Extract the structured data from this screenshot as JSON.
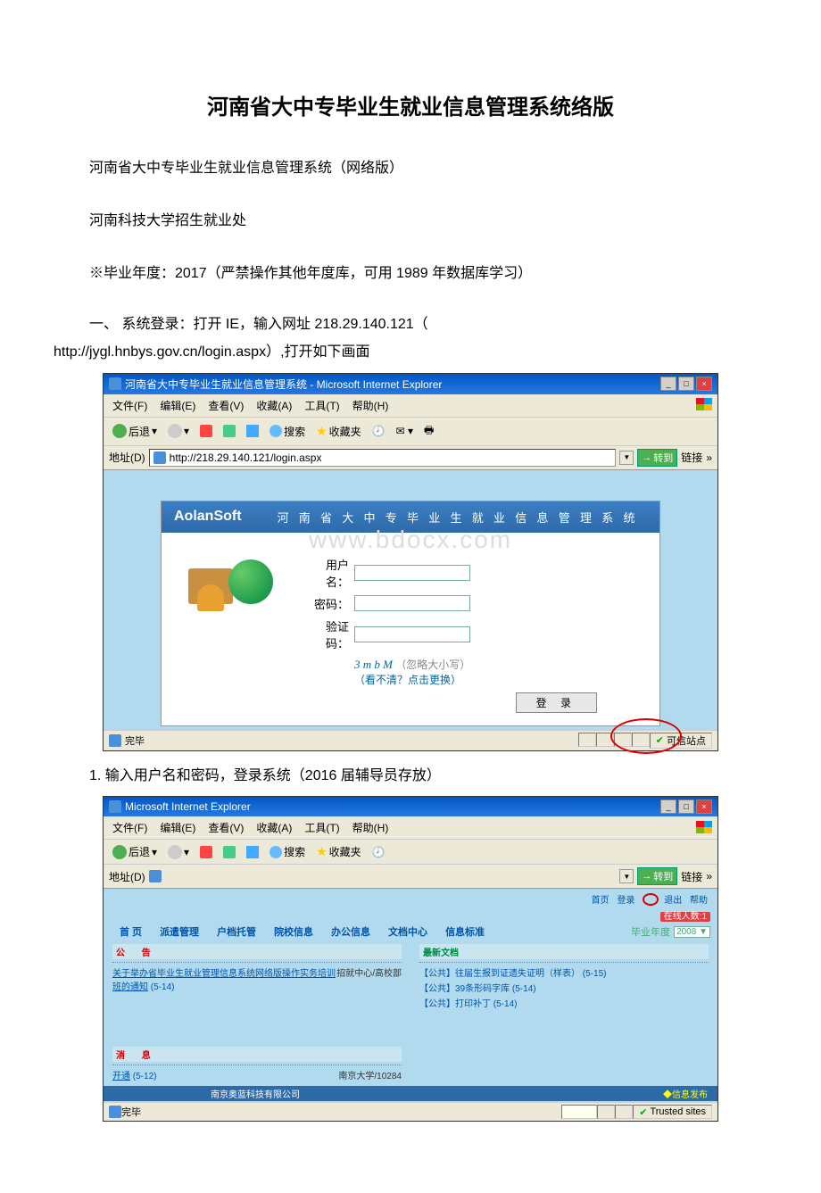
{
  "doc": {
    "title": "河南省大中专毕业生就业信息管理系统络版",
    "p1": "河南省大中专毕业生就业信息管理系统（网络版）",
    "p2": "河南科技大学招生就业处",
    "p3": "※毕业年度：2017（严禁操作其他年度库，可用 1989 年数据库学习）",
    "p4": "一、 系统登录：打开 IE，输入网址 218.29.140.121（",
    "p4url": "http://jygl.hnbys.gov.cn/login.aspx）,打开如下画面",
    "p5": "1. 输入用户名和密码，登录系统（2016 届辅导员存放）"
  },
  "ie1": {
    "title": "河南省大中专毕业生就业信息管理系统 - Microsoft Internet Explorer",
    "menu": {
      "file": "文件(F)",
      "edit": "编辑(E)",
      "view": "查看(V)",
      "fav": "收藏(A)",
      "tools": "工具(T)",
      "help": "帮助(H)"
    },
    "toolbar": {
      "back": "后退",
      "search": "搜索",
      "favorites": "收藏夹"
    },
    "address": {
      "label": "地址(D)",
      "url": "http://218.29.140.121/login.aspx",
      "go": "转到",
      "links": "链接"
    },
    "login": {
      "logo": "AolanSoft",
      "system_title": "河 南 省 大 中 专 毕 业 生 就 业 信 息 管 理 系 统",
      "watermark": "www.bdocx.com",
      "username_label": "用户名：",
      "password_label": "密码：",
      "captcha_label": "验证码：",
      "captcha_value": "3 m b M",
      "captcha_hint": "（忽略大小写）",
      "captcha_link": "（看不清？点击更换）",
      "login_btn": "登 录"
    },
    "status": {
      "done": "完毕",
      "trusted": "可信站点"
    }
  },
  "ie2": {
    "title": "Microsoft Internet Explorer",
    "menu": {
      "file": "文件(F)",
      "edit": "编辑(E)",
      "view": "查看(V)",
      "fav": "收藏(A)",
      "tools": "工具(T)",
      "help": "帮助(H)"
    },
    "toolbar": {
      "back": "后退",
      "search": "搜索",
      "favorites": "收藏夹"
    },
    "address": {
      "label": "地址(D)",
      "go": "转到",
      "links": "链接"
    },
    "toplinks": {
      "home": "首页",
      "login": "登录",
      "logout": "退出",
      "help": "帮助"
    },
    "online": {
      "label": "在线人数:",
      "count": "1"
    },
    "navtabs": {
      "t1": "首 页",
      "t2": "派遣管理",
      "t3": "户档托管",
      "t4": "院校信息",
      "t5": "办公信息",
      "t6": "文档中心",
      "t7": "信息标准",
      "year_label": "毕业年度",
      "year_value": "2008"
    },
    "left": {
      "notice_hdr": "公  告",
      "notice_item": "关于举办省毕业生就业管理信息系统网络版操作实务培训班的通知",
      "notice_date": "(5-14)",
      "notice_src": "招就中心/高校部",
      "msg_hdr": "消  息",
      "msg_item": "开通",
      "msg_date": "(5-12)",
      "msg_src": "南京大学/10284"
    },
    "right": {
      "docs_hdr": "最新文档",
      "d1": "【公共】往届生报到证遗失证明（样表）",
      "d1_date": "(5-15)",
      "d2": "【公共】39条形码字库",
      "d2_date": "(5-14)",
      "d3": "【公共】打印补丁",
      "d3_date": "(5-14)"
    },
    "footer": {
      "company": "南京奥蓝科技有限公司",
      "publish": "◆信息发布"
    },
    "status": {
      "done": "完毕",
      "trusted": "Trusted sites"
    }
  }
}
